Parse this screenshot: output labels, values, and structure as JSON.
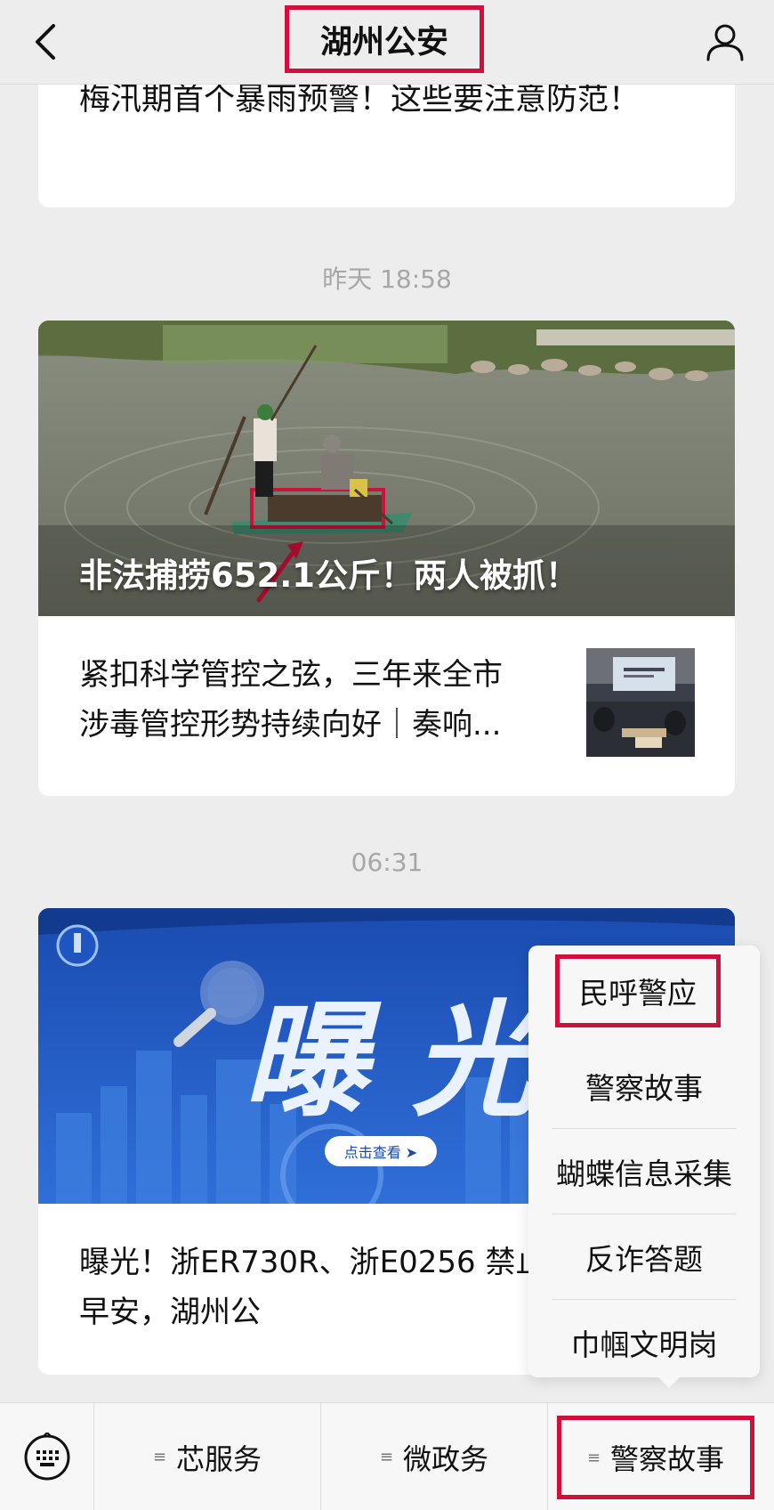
{
  "header": {
    "title": "湖州公安",
    "back_icon": "chevron-left-icon",
    "profile_icon": "person-icon"
  },
  "messages": [
    {
      "text": "梅汛期首个暴雨预警！这些要注意防范！"
    },
    {
      "timestamp": "昨天 18:58",
      "cover_title": "非法捕捞652.1公斤！两人被抓！",
      "secondary_text": "紧扣科学管控之弦，三年来全市涉毒管控形势持续向好｜奏响..."
    },
    {
      "timestamp": "06:31",
      "cover_text": "曝 光",
      "cover_button": "点击查看 ➤",
      "secondary_text": "曝光！浙ER730R、浙E0256 禁止做这种事！早安，湖州公"
    }
  ],
  "popup": {
    "items": [
      "民呼警应",
      "警察故事",
      "蝴蝶信息采集",
      "反诈答题",
      "巾帼文明岗"
    ]
  },
  "bottom_bar": {
    "keyboard_icon": "keyboard-icon",
    "tabs": [
      "芯服务",
      "微政务",
      "警察故事"
    ]
  },
  "colors": {
    "highlight": "#d0103a",
    "background": "#ededed"
  }
}
